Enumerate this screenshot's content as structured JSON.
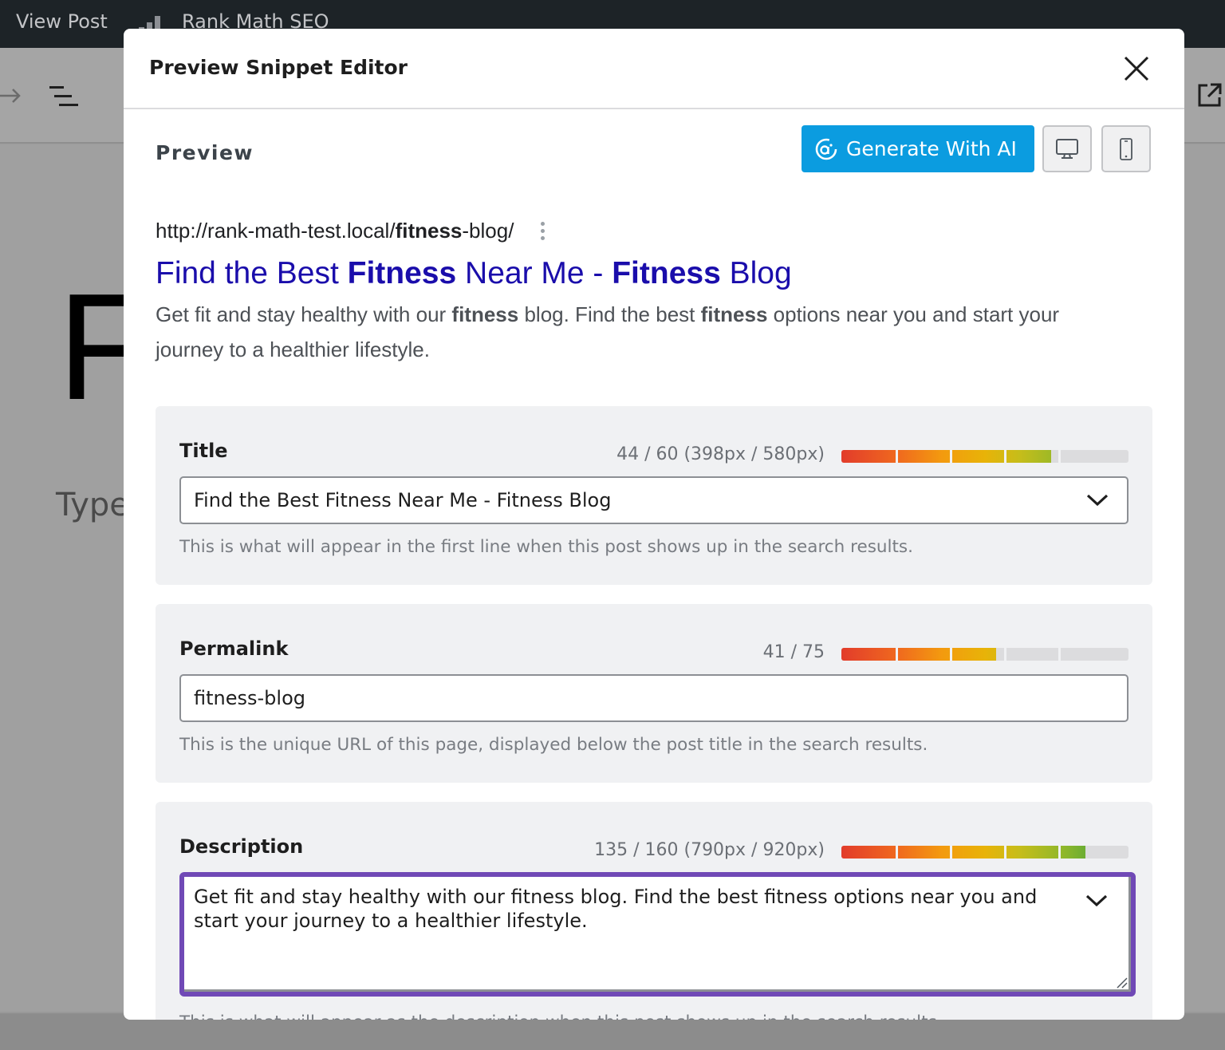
{
  "admin_bar": {
    "view_post": "View Post",
    "plugin_label": "Rank Math SEO"
  },
  "editor": {
    "title_initial": "F",
    "block_hint": "Type"
  },
  "modal": {
    "title": "Preview Snippet Editor",
    "preview_label": "Preview",
    "generate_ai_label": "Generate With AI",
    "device_buttons": [
      "desktop",
      "mobile"
    ]
  },
  "serp": {
    "url_prefix": "http://rank-math-test.local/",
    "url_keyword": "fitness",
    "url_suffix": "-blog/",
    "title_parts": [
      {
        "text": "Find the Best ",
        "bold": false
      },
      {
        "text": "Fitness",
        "bold": true
      },
      {
        "text": " Near Me - ",
        "bold": false
      },
      {
        "text": "Fitness",
        "bold": true
      },
      {
        "text": " Blog",
        "bold": false
      }
    ],
    "description_parts": [
      {
        "text": "Get fit and stay healthy with our ",
        "bold": false
      },
      {
        "text": "fitness",
        "bold": true
      },
      {
        "text": " blog. Find the best ",
        "bold": false
      },
      {
        "text": "fitness",
        "bold": true
      },
      {
        "text": " options near you and start your journey to a healthier lifestyle.",
        "bold": false
      }
    ]
  },
  "fields": {
    "title": {
      "label": "Title",
      "count": "44 / 60 (398px / 580px)",
      "meter_fraction": 0.73,
      "value": "Find the Best Fitness Near Me - Fitness Blog",
      "help": "This is what will appear in the first line when this post shows up in the search results."
    },
    "permalink": {
      "label": "Permalink",
      "count": "41 / 75",
      "meter_fraction": 0.54,
      "value": "fitness-blog",
      "help": "This is the unique URL of this page, displayed below the post title in the search results."
    },
    "description": {
      "label": "Description",
      "count": "135 / 160 (790px / 920px)",
      "meter_fraction": 0.85,
      "value": "Get fit and stay healthy with our fitness blog. Find the best fitness options near you and start your journey to a healthier lifestyle.",
      "help": "This is what will appear as the description when this post shows up in the search results."
    }
  },
  "colors": {
    "ai_button": "#0b9ce0",
    "serp_title": "#1a0dab",
    "focus_border": "#7049b6"
  }
}
